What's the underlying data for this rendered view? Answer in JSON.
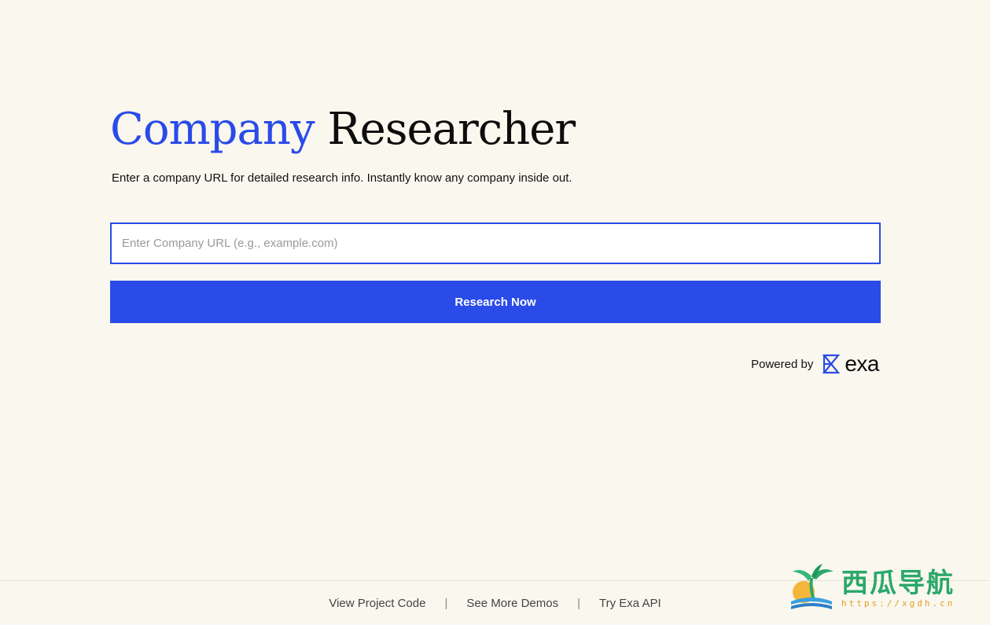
{
  "header": {
    "title_accent": "Company",
    "title_rest": "Researcher",
    "subtitle": "Enter a company URL for detailed research info. Instantly know any company inside out."
  },
  "search": {
    "value": "",
    "placeholder": "Enter Company URL (e.g., example.com)"
  },
  "actions": {
    "research_label": "Research Now"
  },
  "powered_by": {
    "label": "Powered by",
    "brand": "exa"
  },
  "footer": {
    "links": [
      "View Project Code",
      "See More Demos",
      "Try Exa API"
    ],
    "separator": "|"
  },
  "watermark": {
    "title": "西瓜导航",
    "url": "https://xgdh.cn"
  },
  "colors": {
    "accent": "#2a4be8",
    "background": "#faf7ee",
    "text": "#111111"
  },
  "icons": {
    "exa_logo": "exa-hourglass-icon",
    "watermark_logo": "palm-island-icon"
  }
}
